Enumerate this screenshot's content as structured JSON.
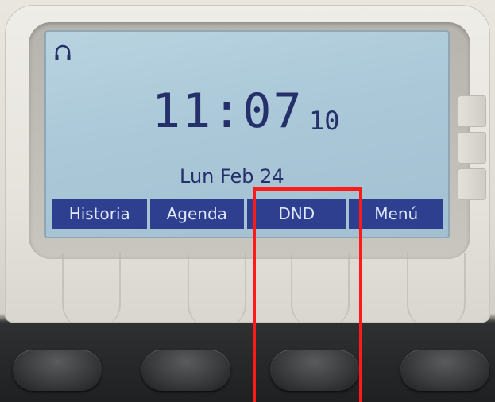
{
  "screen": {
    "time": "11:07",
    "seconds": "10",
    "date": "Lun Feb 24",
    "status_icon": "headset-icon"
  },
  "softkeys": [
    {
      "label": "Historia"
    },
    {
      "label": "Agenda"
    },
    {
      "label": "DND"
    },
    {
      "label": "Menú"
    }
  ],
  "colors": {
    "lcd_background": "#aac8d8",
    "lcd_text": "#25306b",
    "softkey_background": "#2f3f8f",
    "softkey_text": "#dfe6ff",
    "highlight": "#ff1a1a"
  }
}
